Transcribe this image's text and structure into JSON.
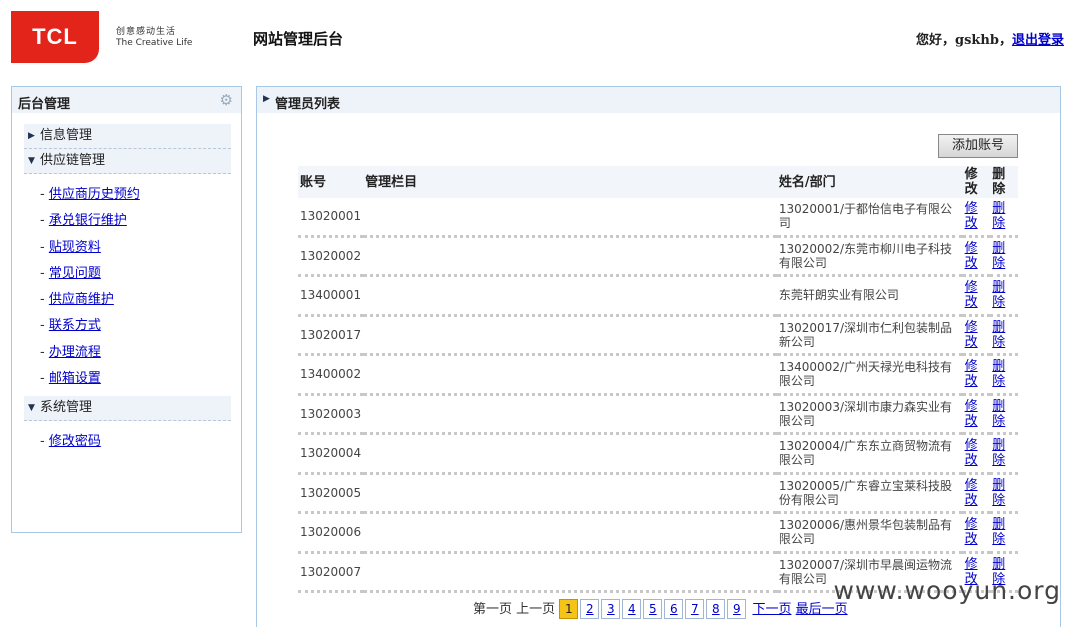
{
  "brand": {
    "logo": "TCL",
    "slogan_cn": "创意感动生活",
    "slogan_en": "The Creative Life"
  },
  "header": {
    "site_title": "网站管理后台",
    "greeting": "您好，",
    "username": "gskhb",
    "separator": "，",
    "logout": "退出登录"
  },
  "sidebar": {
    "title": "后台管理",
    "sections": [
      {
        "label": "信息管理",
        "expanded": false
      },
      {
        "label": "供应链管理",
        "expanded": true,
        "items": [
          "供应商历史预约",
          "承兑银行维护",
          "贴现资料",
          "常见问题",
          "供应商维护",
          "联系方式",
          "办理流程",
          "邮箱设置"
        ]
      },
      {
        "label": "系统管理",
        "expanded": true,
        "items": [
          "修改密码"
        ]
      }
    ]
  },
  "main": {
    "title": "管理员列表",
    "add_button": "添加账号",
    "columns": {
      "account": "账号",
      "columns": "管理栏目",
      "name_dept": "姓名/部门",
      "edit": "修改",
      "delete": "删除"
    },
    "rows": [
      {
        "account": "13020001",
        "name_dept": "13020001/于都怡信电子有限公司",
        "edit": "修改",
        "delete": "删除"
      },
      {
        "account": "13020002",
        "name_dept": "13020002/东莞市柳川电子科技有限公司",
        "edit": "修改",
        "delete": "删除"
      },
      {
        "account": "13400001",
        "name_dept": "东莞轩朗实业有限公司",
        "edit": "修改",
        "delete": "删除"
      },
      {
        "account": "13020017",
        "name_dept": "13020017/深圳市仁利包装制品新公司",
        "edit": "修改",
        "delete": "删除"
      },
      {
        "account": "13400002",
        "name_dept": "13400002/广州天禄光电科技有限公司",
        "edit": "修改",
        "delete": "删除"
      },
      {
        "account": "13020003",
        "name_dept": "13020003/深圳市康力森实业有限公司",
        "edit": "修改",
        "delete": "删除"
      },
      {
        "account": "13020004",
        "name_dept": "13020004/广东东立商贸物流有限公司",
        "edit": "修改",
        "delete": "删除"
      },
      {
        "account": "13020005",
        "name_dept": "13020005/广东睿立宝莱科技股份有限公司",
        "edit": "修改",
        "delete": "删除"
      },
      {
        "account": "13020006",
        "name_dept": "13020006/惠州景华包装制品有限公司",
        "edit": "修改",
        "delete": "删除"
      },
      {
        "account": "13020007",
        "name_dept": "13020007/深圳市早晨闽运物流有限公司",
        "edit": "修改",
        "delete": "删除"
      }
    ]
  },
  "pager": {
    "first": "第一页",
    "prev": "上一页",
    "pages": [
      "1",
      "2",
      "3",
      "4",
      "5",
      "6",
      "7",
      "8",
      "9"
    ],
    "current": "1",
    "next": "下一页",
    "last": "最后一页"
  },
  "watermark": "www.wooyun.org",
  "icons": {
    "settings": "gear-icon",
    "expand": "triangle-down-icon",
    "collapse": "triangle-right-icon"
  },
  "colors": {
    "brand_red": "#e3241b",
    "panel_border": "#a9c8e6",
    "current_page": "#f5c416"
  }
}
